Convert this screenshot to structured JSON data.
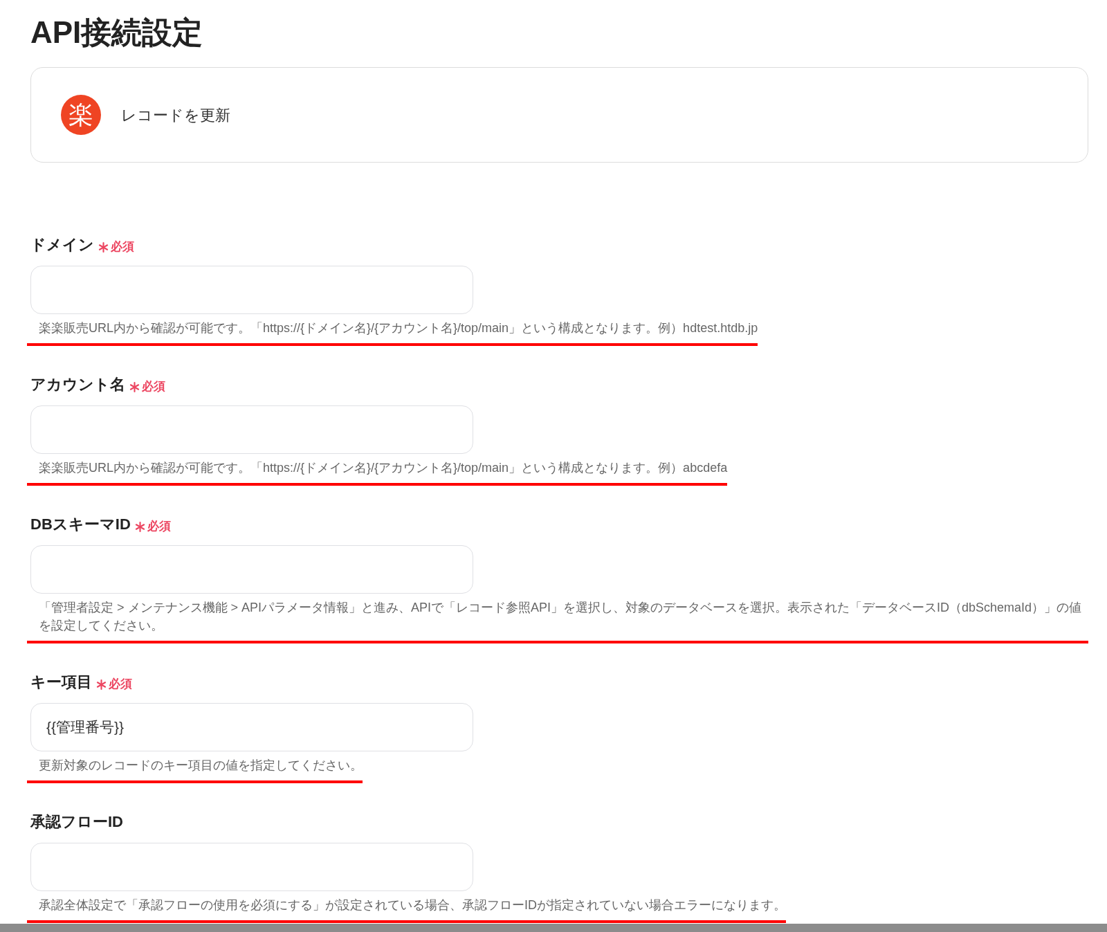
{
  "page": {
    "title": "API接続設定"
  },
  "action_card": {
    "logo_text": "楽",
    "action": "レコードを更新"
  },
  "fields": [
    {
      "label": "ドメイン",
      "required": true,
      "required_text": "必須",
      "hint": "楽楽販売URL内から確認が可能です。「https://{ドメイン名}/{アカウント名}/top/main」という構成となります。例）hdtest.htdb.jp",
      "underlined": true
    },
    {
      "label": "アカウント名",
      "required": true,
      "required_text": "必須",
      "hint": "楽楽販売URL内から確認が可能です。「https://{ドメイン名}/{アカウント名}/top/main」という構成となります。例）abcdefa",
      "underlined": true
    },
    {
      "label": "DBスキーマID",
      "required": true,
      "required_text": "必須",
      "hint": "「管理者設定 > メンテナンス機能 > APIパラメータ情報」と進み、APIで「レコード参照API」を選択し、対象のデータベースを選択。表示された「データベースID（dbSchemaId）」の値を設定してください。",
      "underlined": true
    },
    {
      "label": "キー項目",
      "required": true,
      "required_text": "必須",
      "value": "{{管理番号}}",
      "hint": "更新対象のレコードのキー項目の値を指定してください。",
      "underlined": true
    },
    {
      "label": "承認フローID",
      "required": false,
      "hint": "承認全体設定で「承認フローの使用を必須にする」が設定されている場合、承認フローIDが指定されていない場合エラーになります。",
      "underlined": true
    }
  ]
}
